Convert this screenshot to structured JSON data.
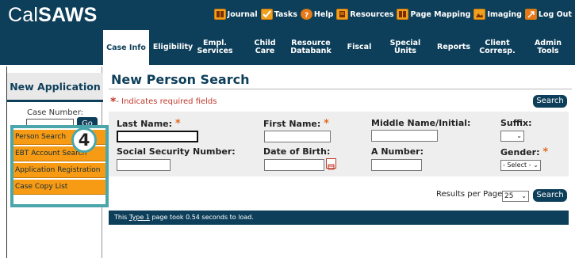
{
  "app": {
    "logo_prefix": "Cal",
    "logo_bold": "SAWS"
  },
  "toplinks": [
    {
      "label": "Journal",
      "icon": "book-icon"
    },
    {
      "label": "Tasks",
      "icon": "checkbox-icon"
    },
    {
      "label": "Help",
      "icon": "help-icon"
    },
    {
      "label": "Resources",
      "icon": "document-icon"
    },
    {
      "label": "Page Mapping",
      "icon": "book-icon"
    },
    {
      "label": "Imaging",
      "icon": "image-icon"
    },
    {
      "label": "Log Out",
      "icon": "logout-icon"
    }
  ],
  "nav": [
    {
      "label": "Case Info",
      "active": true
    },
    {
      "label": "Eligibility"
    },
    {
      "label": "Empl. Services"
    },
    {
      "label": "Child Care"
    },
    {
      "label": "Resource Databank"
    },
    {
      "label": "Fiscal"
    },
    {
      "label": "Special Units"
    },
    {
      "label": "Reports"
    },
    {
      "label": "Client Corresp."
    },
    {
      "label": "Admin Tools"
    }
  ],
  "sidebar": {
    "title": "New Application",
    "case_number_label": "Case Number:",
    "go_label": "Go",
    "menu": [
      "Person Search",
      "EBT Account Search",
      "Application Registration",
      "Case Copy List"
    ],
    "callout_number": "4"
  },
  "main": {
    "title": "New Person Search",
    "required_note": "- Indicates required fields",
    "required_mark": "*",
    "search_label": "Search",
    "fields": {
      "last_name": {
        "label": "Last Name:",
        "required": true,
        "value": ""
      },
      "first_name": {
        "label": "First Name:",
        "required": true,
        "value": ""
      },
      "middle_name": {
        "label": "Middle Name/Initial:",
        "value": ""
      },
      "suffix": {
        "label": "Suffix:",
        "value": ""
      },
      "ssn": {
        "label": "Social Security Number:",
        "value": ""
      },
      "dob": {
        "label": "Date of Birth:",
        "value": ""
      },
      "a_number": {
        "label": "A Number:",
        "value": ""
      },
      "gender": {
        "label": "Gender:",
        "required": true,
        "value": "- Select -"
      }
    },
    "results_per_page_label": "Results per Page:",
    "results_per_page_value": "25",
    "status_prefix": "This ",
    "status_link": "Type 1",
    "status_suffix": " page took 0.54 seconds to load."
  }
}
